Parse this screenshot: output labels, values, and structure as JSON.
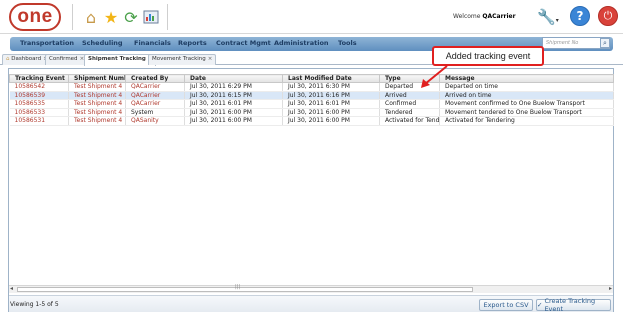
{
  "header": {
    "logo_text": "one",
    "welcome_prefix": "Welcome",
    "username": "QACarrier"
  },
  "nav": {
    "items": [
      "Transportation",
      "Scheduling",
      "Financials",
      "Reports",
      "Contract Mgmt",
      "Administration",
      "Tools"
    ],
    "search_placeholder": "Shipment No"
  },
  "tabs": [
    {
      "label": "Dashboard",
      "active": false
    },
    {
      "label": "Confirmed",
      "active": false
    },
    {
      "label": "Shipment Tracking",
      "active": true
    },
    {
      "label": "Movement Tracking",
      "active": false
    }
  ],
  "callout": {
    "text": "Added tracking event"
  },
  "table": {
    "columns": [
      "Tracking Event",
      "Shipment Number",
      "Created By",
      "Date",
      "Last Modified Date",
      "Type",
      "Message"
    ],
    "rows": [
      [
        "10586542",
        "Test Shipment 4",
        "QACarrier",
        "Jul 30, 2011 6:29 PM",
        "Jul 30, 2011 6:30 PM",
        "Departed",
        "Departed on time"
      ],
      [
        "10586539",
        "Test Shipment 4",
        "QACarrier",
        "Jul 30, 2011 6:15 PM",
        "Jul 30, 2011 6:16 PM",
        "Arrived",
        "Arrived on time"
      ],
      [
        "10586535",
        "Test Shipment 4",
        "QACarrier",
        "Jul 30, 2011 6:01 PM",
        "Jul 30, 2011 6:01 PM",
        "Confirmed",
        "Movement confirmed to One Buelow Transport"
      ],
      [
        "10586533",
        "Test Shipment 4",
        "System",
        "Jul 30, 2011 6:00 PM",
        "Jul 30, 2011 6:00 PM",
        "Tendered",
        "Movement tendered to One Buelow Transport"
      ],
      [
        "10586531",
        "Test Shipment 4",
        "QASanity",
        "Jul 30, 2011 6:00 PM",
        "Jul 30, 2011 6:00 PM",
        "Activated for Tendering",
        "Activated for Tendering"
      ]
    ],
    "selected_row": 1
  },
  "footer": {
    "viewing": "Viewing 1-5 of 5",
    "export_label": "Export to CSV",
    "create_label": "Create Tracking Event"
  },
  "colors": {
    "link": "#b03a2e",
    "selected_row": "#d9e7f7",
    "callout_border": "#e02020",
    "nav_bar": "#6f9cc8"
  }
}
